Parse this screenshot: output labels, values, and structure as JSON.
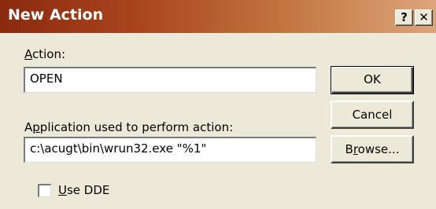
{
  "window": {
    "title": "New Action",
    "help_label": "?",
    "close_label": "✕"
  },
  "action": {
    "label_prefix": "",
    "label_mnemonic": "A",
    "label_rest": "ction:",
    "value": "OPEN"
  },
  "application": {
    "label_prefix": "A",
    "label_mnemonic": "p",
    "label_rest": "plication used to perform action:",
    "value": "c:\\acugt\\bin\\wrun32.exe \"%1\""
  },
  "buttons": {
    "ok": "OK",
    "cancel": "Cancel",
    "browse_prefix": "B",
    "browse_mnemonic": "r",
    "browse_rest": "owse..."
  },
  "dde": {
    "label_mnemonic": "U",
    "label_rest": "se DDE",
    "checked": false
  }
}
